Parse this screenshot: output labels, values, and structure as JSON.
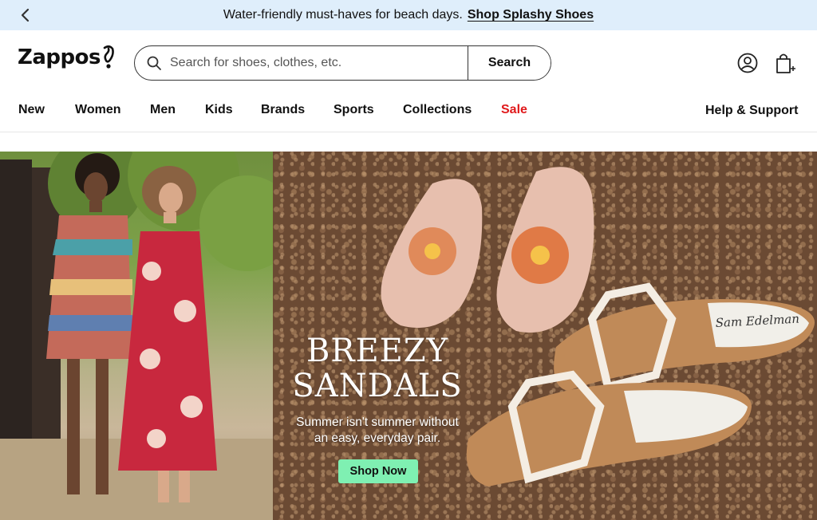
{
  "promo": {
    "text": "Water-friendly must-haves for beach days.",
    "link": "Shop Splashy Shoes",
    "back_icon": "chevron-left-icon"
  },
  "header": {
    "logo_text": "Zappos",
    "search_placeholder": "Search for shoes, clothes, etc.",
    "search_button": "Search",
    "search_icon": "search-icon",
    "account_icon": "user-icon",
    "cart_icon": "shopping-bag-icon"
  },
  "nav": {
    "items": [
      "New",
      "Women",
      "Men",
      "Kids",
      "Brands",
      "Sports",
      "Collections",
      "Sale"
    ],
    "help": "Help & Support",
    "sale_color": "#e0191b"
  },
  "hero": {
    "headline_line1": "BREEZY",
    "headline_line2": "SANDALS",
    "subtitle_line1": "Summer isn't summer without",
    "subtitle_line2": "an easy, everyday pair.",
    "cta": "Shop Now",
    "cta_color": "#7ff0b2",
    "brand_print": "Sam Edelman"
  }
}
